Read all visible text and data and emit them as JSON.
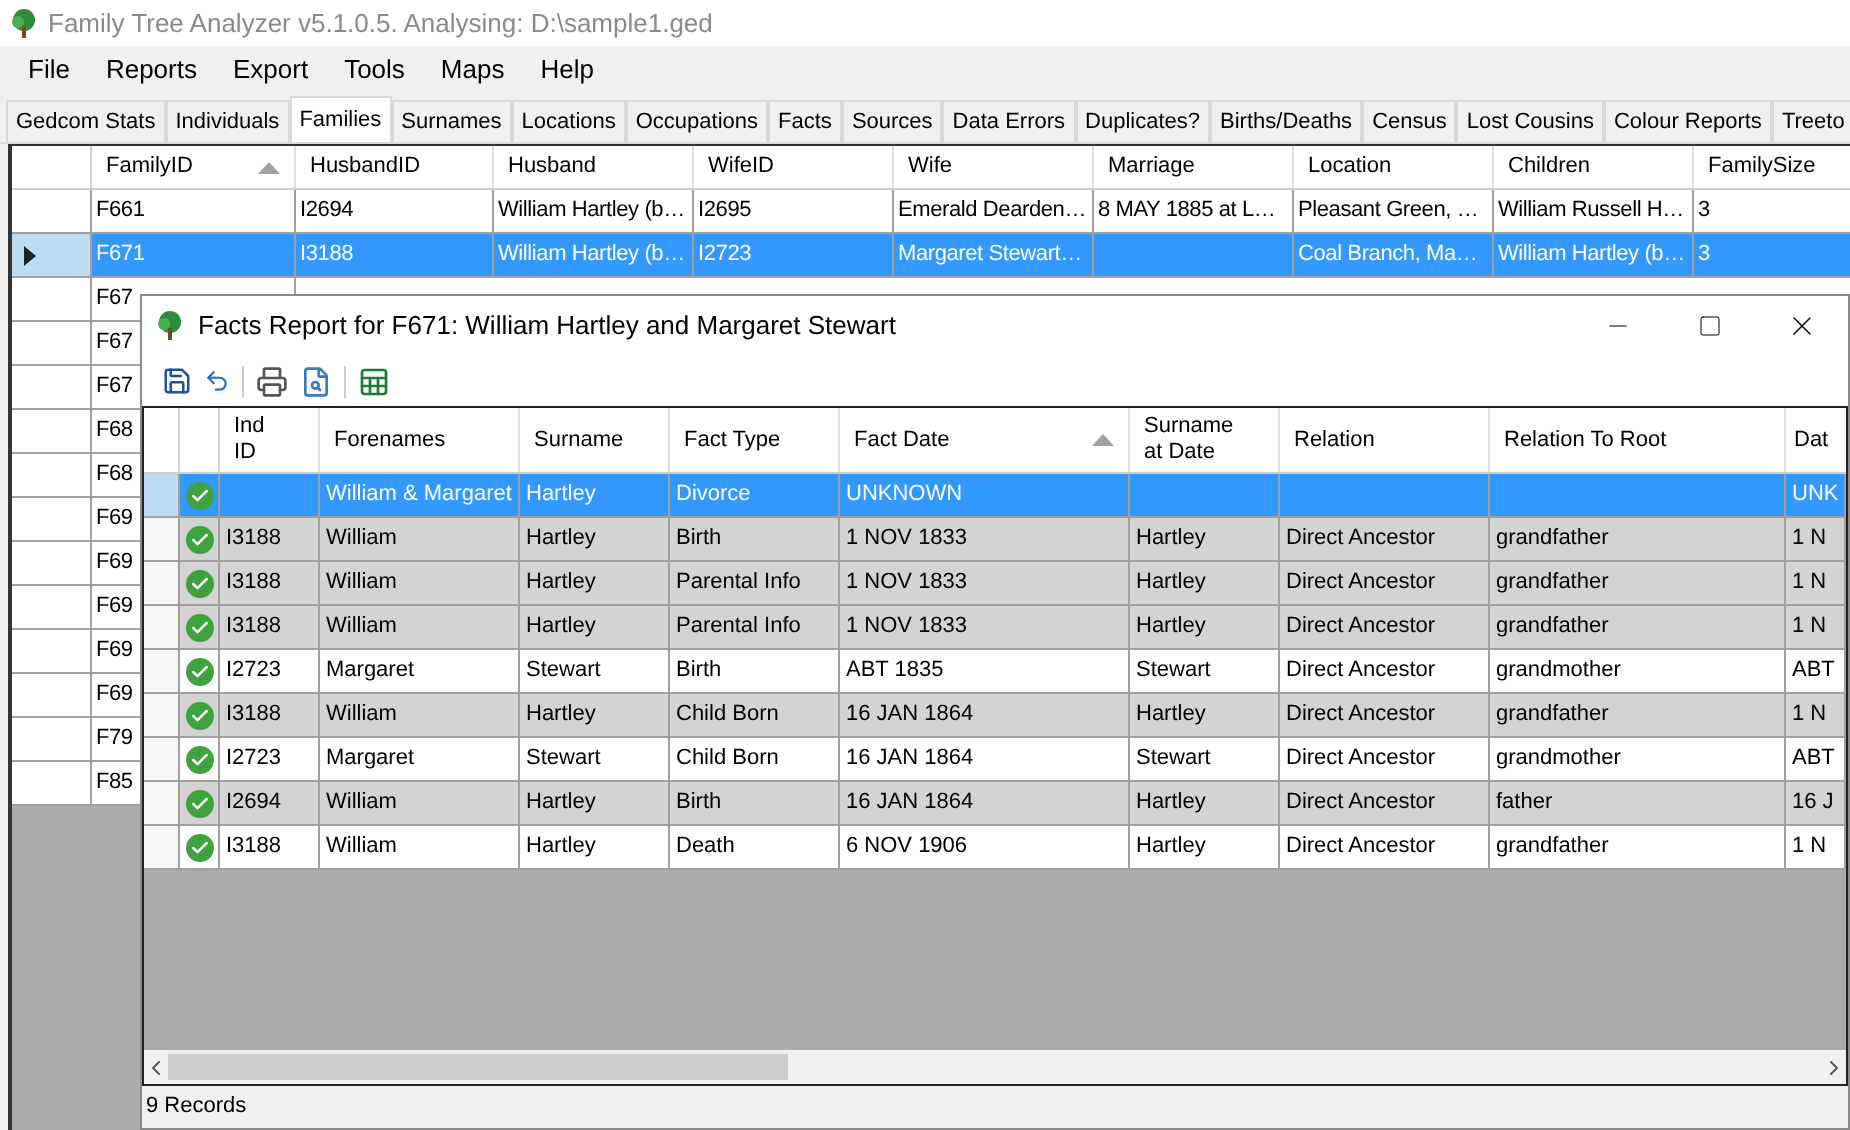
{
  "window": {
    "title": "Family Tree Analyzer v5.1.0.5. Analysing: D:\\sample1.ged"
  },
  "menu": [
    "File",
    "Reports",
    "Export",
    "Tools",
    "Maps",
    "Help"
  ],
  "tabs": [
    {
      "label": "Gedcom Stats",
      "selected": false
    },
    {
      "label": "Individuals",
      "selected": false
    },
    {
      "label": "Families",
      "selected": true
    },
    {
      "label": "Surnames",
      "selected": false
    },
    {
      "label": "Locations",
      "selected": false
    },
    {
      "label": "Occupations",
      "selected": false
    },
    {
      "label": "Facts",
      "selected": false
    },
    {
      "label": "Sources",
      "selected": false
    },
    {
      "label": "Data Errors",
      "selected": false
    },
    {
      "label": "Duplicates?",
      "selected": false
    },
    {
      "label": "Births/Deaths",
      "selected": false
    },
    {
      "label": "Census",
      "selected": false
    },
    {
      "label": "Lost Cousins",
      "selected": false
    },
    {
      "label": "Colour Reports",
      "selected": false
    },
    {
      "label": "Treeto",
      "selected": false
    }
  ],
  "families": {
    "columns": [
      {
        "label": "FamilyID",
        "sorted": true
      },
      {
        "label": "HusbandID",
        "sorted": false
      },
      {
        "label": "Husband",
        "sorted": false
      },
      {
        "label": "WifeID",
        "sorted": false
      },
      {
        "label": "Wife",
        "sorted": false
      },
      {
        "label": "Marriage",
        "sorted": false
      },
      {
        "label": "Location",
        "sorted": false
      },
      {
        "label": "Children",
        "sorted": false
      },
      {
        "label": "FamilySize",
        "sorted": false
      }
    ],
    "rows": [
      {
        "selected": false,
        "cells": [
          "F661",
          "I2694",
          "William Hartley (b…",
          "I2695",
          "Emerald Dearden…",
          "8 MAY 1885 at L…",
          "Pleasant Green, …",
          "William Russell H…",
          "3"
        ]
      },
      {
        "selected": true,
        "cells": [
          "F671",
          "I3188",
          "William Hartley (b…",
          "I2723",
          "Margaret Stewart…",
          "",
          "Coal Branch, Ma…",
          "William Hartley (b…",
          "3"
        ]
      },
      {
        "selected": false,
        "cells": [
          "F67"
        ]
      },
      {
        "selected": false,
        "cells": [
          "F67"
        ]
      },
      {
        "selected": false,
        "cells": [
          "F67"
        ]
      },
      {
        "selected": false,
        "cells": [
          "F68"
        ]
      },
      {
        "selected": false,
        "cells": [
          "F68"
        ]
      },
      {
        "selected": false,
        "cells": [
          "F69"
        ]
      },
      {
        "selected": false,
        "cells": [
          "F69"
        ]
      },
      {
        "selected": false,
        "cells": [
          "F69"
        ]
      },
      {
        "selected": false,
        "cells": [
          "F69"
        ]
      },
      {
        "selected": false,
        "cells": [
          "F69"
        ]
      },
      {
        "selected": false,
        "cells": [
          "F79"
        ]
      },
      {
        "selected": false,
        "cells": [
          "F85"
        ]
      }
    ]
  },
  "dialog": {
    "title": "Facts Report for F671: William Hartley and Margaret Stewart",
    "columns": [
      {
        "label": "Ind ID",
        "sorted": false
      },
      {
        "label": "Forenames",
        "sorted": false
      },
      {
        "label": "Surname",
        "sorted": false
      },
      {
        "label": "Fact Type",
        "sorted": false
      },
      {
        "label": "Fact Date",
        "sorted": true
      },
      {
        "label": "Surname at Date",
        "sorted": false
      },
      {
        "label": "Relation",
        "sorted": false
      },
      {
        "label": "Relation To Root",
        "sorted": false
      },
      {
        "label": "Dat",
        "sorted": false
      }
    ],
    "rows": [
      {
        "selected": true,
        "cells": [
          "",
          "William & Margaret",
          "Hartley",
          "Divorce",
          "UNKNOWN",
          "",
          "",
          "",
          "UNK"
        ]
      },
      {
        "selected": false,
        "highlighted": true,
        "cells": [
          "I3188",
          "William",
          "Hartley",
          "Birth",
          "1 NOV 1833",
          "Hartley",
          "Direct Ancestor",
          "grandfather",
          "1 N"
        ]
      },
      {
        "selected": false,
        "highlighted": true,
        "cells": [
          "I3188",
          "William",
          "Hartley",
          "Parental Info",
          "1 NOV 1833",
          "Hartley",
          "Direct Ancestor",
          "grandfather",
          "1 N"
        ]
      },
      {
        "selected": false,
        "highlighted": true,
        "cells": [
          "I3188",
          "William",
          "Hartley",
          "Parental Info",
          "1 NOV 1833",
          "Hartley",
          "Direct Ancestor",
          "grandfather",
          "1 N"
        ]
      },
      {
        "selected": false,
        "highlighted": false,
        "cells": [
          "I2723",
          "Margaret",
          "Stewart",
          "Birth",
          "ABT 1835",
          "Stewart",
          "Direct Ancestor",
          "grandmother",
          "ABT"
        ]
      },
      {
        "selected": false,
        "highlighted": true,
        "cells": [
          "I3188",
          "William",
          "Hartley",
          "Child Born",
          "16 JAN 1864",
          "Hartley",
          "Direct Ancestor",
          "grandfather",
          "1 N"
        ]
      },
      {
        "selected": false,
        "highlighted": false,
        "cells": [
          "I2723",
          "Margaret",
          "Stewart",
          "Child Born",
          "16 JAN 1864",
          "Stewart",
          "Direct Ancestor",
          "grandmother",
          "ABT"
        ]
      },
      {
        "selected": false,
        "highlighted": true,
        "cells": [
          "I2694",
          "William",
          "Hartley",
          "Birth",
          "16 JAN 1864",
          "Hartley",
          "Direct Ancestor",
          "father",
          "16 J"
        ]
      },
      {
        "selected": false,
        "highlighted": false,
        "cells": [
          "I3188",
          "William",
          "Hartley",
          "Death",
          "6 NOV 1906",
          "Hartley",
          "Direct Ancestor",
          "grandfather",
          "1 N"
        ]
      }
    ],
    "status": "9 Records"
  }
}
